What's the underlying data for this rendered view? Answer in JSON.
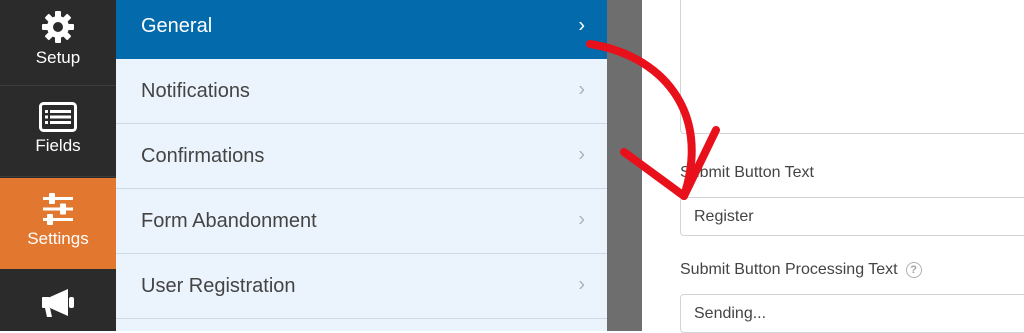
{
  "sidebar": {
    "items": [
      {
        "label": "Setup",
        "icon": "gear-icon"
      },
      {
        "label": "Fields",
        "icon": "fields-list-icon"
      },
      {
        "label": "Settings",
        "icon": "sliders-icon",
        "active": true
      },
      {
        "label": "",
        "icon": "megaphone-icon"
      }
    ],
    "active_color": "#e27730"
  },
  "settings_menu": {
    "items": [
      {
        "label": "General",
        "active": true
      },
      {
        "label": "Notifications"
      },
      {
        "label": "Confirmations"
      },
      {
        "label": "Form Abandonment"
      },
      {
        "label": "User Registration"
      }
    ],
    "active_color": "#036aab"
  },
  "form": {
    "submit_text_label": "Submit Button Text",
    "submit_text_value": "Register",
    "processing_text_label": "Submit Button Processing Text",
    "processing_text_value": "Sending...",
    "help_symbol": "?"
  },
  "annotation": {
    "arrow_color": "#e8101a"
  }
}
